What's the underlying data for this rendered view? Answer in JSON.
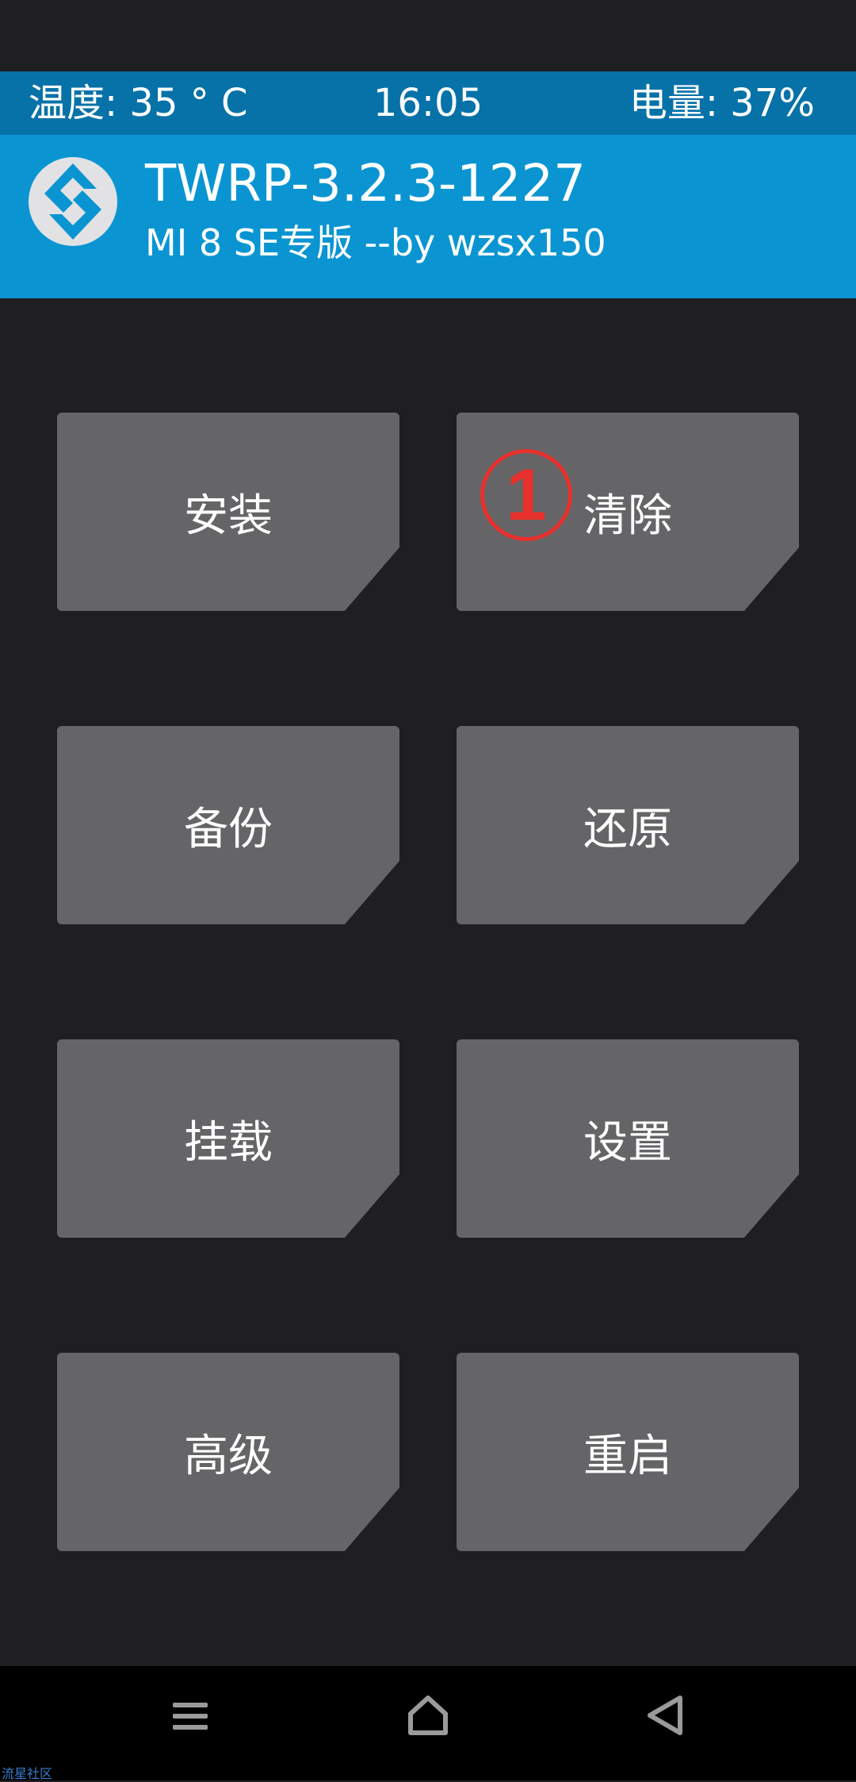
{
  "status": {
    "temperature": "温度: 35 ° C",
    "time": "16:05",
    "battery": "电量: 37%"
  },
  "header": {
    "title": "TWRP-3.2.3-1227",
    "subtitle": "MI 8 SE专版  --by wzsx150"
  },
  "menu": [
    {
      "label": "安装"
    },
    {
      "label": "清除"
    },
    {
      "label": "备份"
    },
    {
      "label": "还原"
    },
    {
      "label": "挂载"
    },
    {
      "label": "设置"
    },
    {
      "label": "高级"
    },
    {
      "label": "重启"
    }
  ],
  "annotation": {
    "marker": "1",
    "color": "#e8302c"
  },
  "navbar": {
    "icons": [
      "menu-icon",
      "home-icon",
      "back-icon"
    ]
  },
  "watermark": "流星社区",
  "colors": {
    "background": "#1f1e21",
    "statusbar": "#0772a8",
    "header": "#0a95d2",
    "button": "#656467"
  }
}
